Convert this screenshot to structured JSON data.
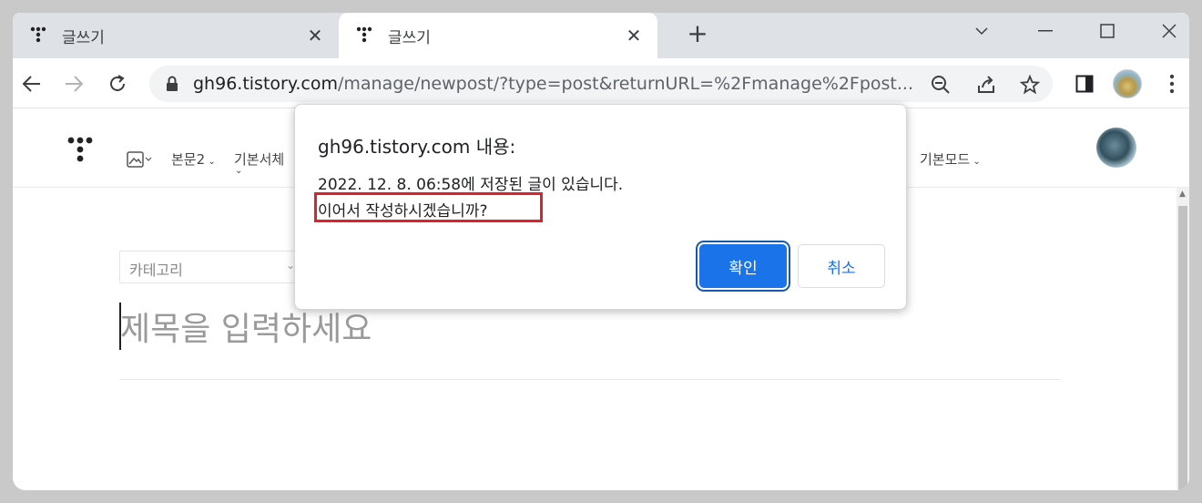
{
  "tabs": [
    {
      "title": "글쓰기",
      "close": "✕"
    },
    {
      "title": "글쓰기",
      "close": "✕"
    }
  ],
  "newtab_label": "+",
  "url": {
    "host": "gh96.tistory.com",
    "path": "/manage/newpost/?type=post&returnURL=%2Fmanage%2Fpost..."
  },
  "editor": {
    "items": [
      "본문2",
      "기본서체",
      "기본모드"
    ],
    "category_placeholder": "카테고리",
    "title_placeholder": "제목을 입력하세요"
  },
  "dialog": {
    "title": "gh96.tistory.com 내용:",
    "message_line1": "2022. 12. 8. 06:58에 저장된 글이 있습니다.",
    "message_line2": "이어서 작성하시겠습니까?",
    "ok_label": "확인",
    "cancel_label": "취소"
  },
  "colors": {
    "accent": "#1a73e8",
    "highlight": "#e0202b",
    "tabstrip": "#dee1e6"
  }
}
